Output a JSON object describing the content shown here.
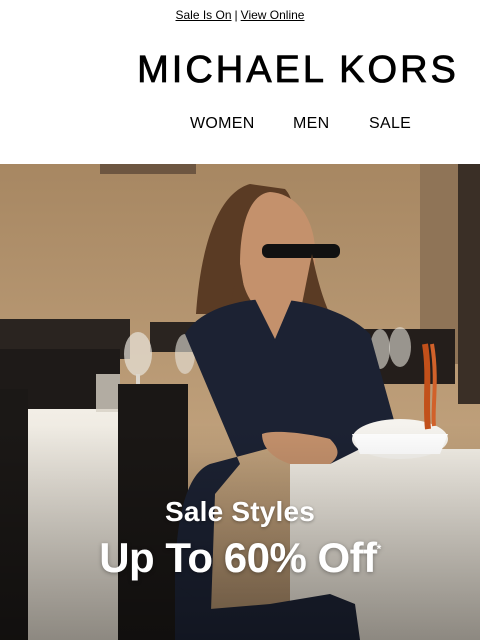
{
  "preheader": {
    "sale_link": "Sale Is On",
    "separator": "|",
    "view_online_link": "View Online"
  },
  "brand": {
    "logo_text": "MICHAEL KORS"
  },
  "nav": {
    "items": [
      {
        "label": "WOMEN"
      },
      {
        "label": "MEN"
      },
      {
        "label": "SALE"
      }
    ]
  },
  "hero": {
    "headline": "Sale Styles",
    "offer": "Up To 60% Off",
    "footnote_mark": "*"
  },
  "colors": {
    "text": "#000000",
    "hero_text": "#ffffff",
    "wall": "#b89a77",
    "blazer": "#1c2233",
    "tablecloth": "#eeeae2"
  }
}
